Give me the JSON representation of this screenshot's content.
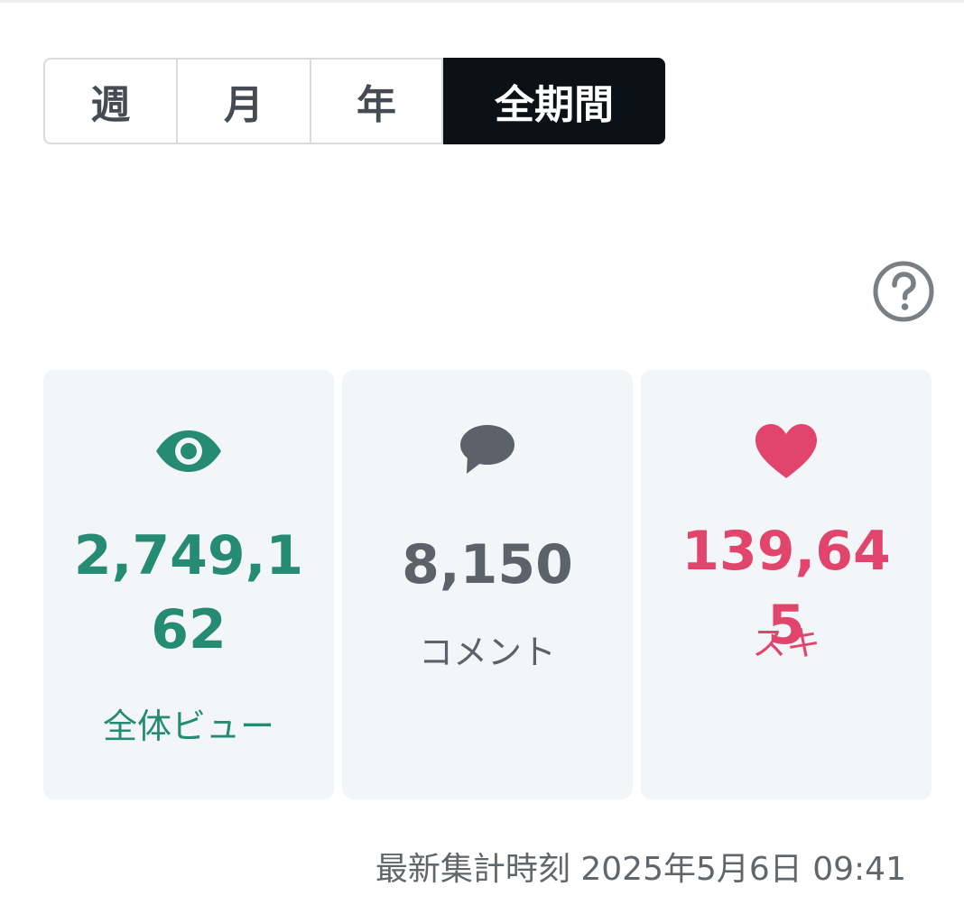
{
  "tabs": [
    {
      "label": "週",
      "active": false
    },
    {
      "label": "月",
      "active": false
    },
    {
      "label": "年",
      "active": false
    },
    {
      "label": "全期間",
      "active": true
    }
  ],
  "help": {
    "icon": "question-circle-icon"
  },
  "stats": {
    "views": {
      "value": "2,749,162",
      "label": "全体ビュー",
      "icon": "eye-icon",
      "color": "#268b73"
    },
    "comments": {
      "value": "8,150",
      "label": "コメント",
      "icon": "speech-bubble-icon",
      "color": "#5c6269"
    },
    "likes": {
      "value": "139,645",
      "label": "スキ",
      "icon": "heart-icon",
      "color": "#e2456b"
    }
  },
  "updated": {
    "label": "最新集計時刻",
    "datetime": "2025年5月6日 09:41"
  },
  "colors": {
    "active_tab": "#0b1217",
    "card_background": "#f3f6f9"
  }
}
